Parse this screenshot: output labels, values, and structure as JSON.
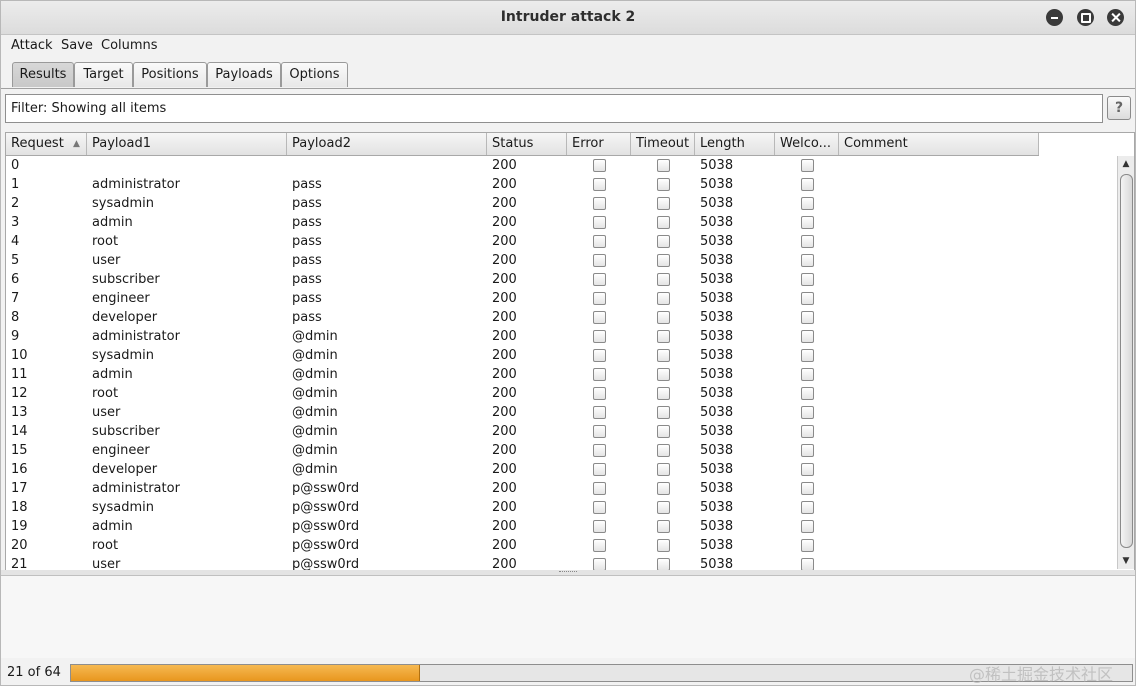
{
  "window": {
    "title": "Intruder attack 2"
  },
  "menu": [
    "Attack",
    "Save",
    "Columns"
  ],
  "tabs": [
    {
      "label": "Results",
      "active": true
    },
    {
      "label": "Target",
      "active": false
    },
    {
      "label": "Positions",
      "active": false
    },
    {
      "label": "Payloads",
      "active": false
    },
    {
      "label": "Options",
      "active": false
    }
  ],
  "filter": {
    "text": "Filter: Showing all items",
    "help": "?"
  },
  "table": {
    "columns": [
      "Request",
      "Payload1",
      "Payload2",
      "Status",
      "Error",
      "Timeout",
      "Length",
      "Welco...",
      "Comment"
    ],
    "sorted_column": "Request",
    "sort_indicator": "▲",
    "rows": [
      {
        "request": "0",
        "payload1": "",
        "payload2": "",
        "status": "200",
        "length": "5038"
      },
      {
        "request": "1",
        "payload1": "administrator",
        "payload2": "pass",
        "status": "200",
        "length": "5038"
      },
      {
        "request": "2",
        "payload1": "sysadmin",
        "payload2": "pass",
        "status": "200",
        "length": "5038"
      },
      {
        "request": "3",
        "payload1": "admin",
        "payload2": "pass",
        "status": "200",
        "length": "5038"
      },
      {
        "request": "4",
        "payload1": "root",
        "payload2": "pass",
        "status": "200",
        "length": "5038"
      },
      {
        "request": "5",
        "payload1": "user",
        "payload2": "pass",
        "status": "200",
        "length": "5038"
      },
      {
        "request": "6",
        "payload1": "subscriber",
        "payload2": "pass",
        "status": "200",
        "length": "5038"
      },
      {
        "request": "7",
        "payload1": "engineer",
        "payload2": "pass",
        "status": "200",
        "length": "5038"
      },
      {
        "request": "8",
        "payload1": "developer",
        "payload2": "pass",
        "status": "200",
        "length": "5038"
      },
      {
        "request": "9",
        "payload1": "administrator",
        "payload2": "@dmin",
        "status": "200",
        "length": "5038"
      },
      {
        "request": "10",
        "payload1": "sysadmin",
        "payload2": "@dmin",
        "status": "200",
        "length": "5038"
      },
      {
        "request": "11",
        "payload1": "admin",
        "payload2": "@dmin",
        "status": "200",
        "length": "5038"
      },
      {
        "request": "12",
        "payload1": "root",
        "payload2": "@dmin",
        "status": "200",
        "length": "5038"
      },
      {
        "request": "13",
        "payload1": "user",
        "payload2": "@dmin",
        "status": "200",
        "length": "5038"
      },
      {
        "request": "14",
        "payload1": "subscriber",
        "payload2": "@dmin",
        "status": "200",
        "length": "5038"
      },
      {
        "request": "15",
        "payload1": "engineer",
        "payload2": "@dmin",
        "status": "200",
        "length": "5038"
      },
      {
        "request": "16",
        "payload1": "developer",
        "payload2": "@dmin",
        "status": "200",
        "length": "5038"
      },
      {
        "request": "17",
        "payload1": "administrator",
        "payload2": "p@ssw0rd",
        "status": "200",
        "length": "5038"
      },
      {
        "request": "18",
        "payload1": "sysadmin",
        "payload2": "p@ssw0rd",
        "status": "200",
        "length": "5038"
      },
      {
        "request": "19",
        "payload1": "admin",
        "payload2": "p@ssw0rd",
        "status": "200",
        "length": "5038"
      },
      {
        "request": "20",
        "payload1": "root",
        "payload2": "p@ssw0rd",
        "status": "200",
        "length": "5038"
      },
      {
        "request": "21",
        "payload1": "user",
        "payload2": "p@ssw0rd",
        "status": "200",
        "length": "5038"
      }
    ]
  },
  "status": {
    "text": "21 of 64",
    "progress_fraction": 0.328
  },
  "watermark": "@稀土掘金技术社区",
  "colors": {
    "progress": "#f0a830",
    "active_tab": "#cfcfcf"
  }
}
